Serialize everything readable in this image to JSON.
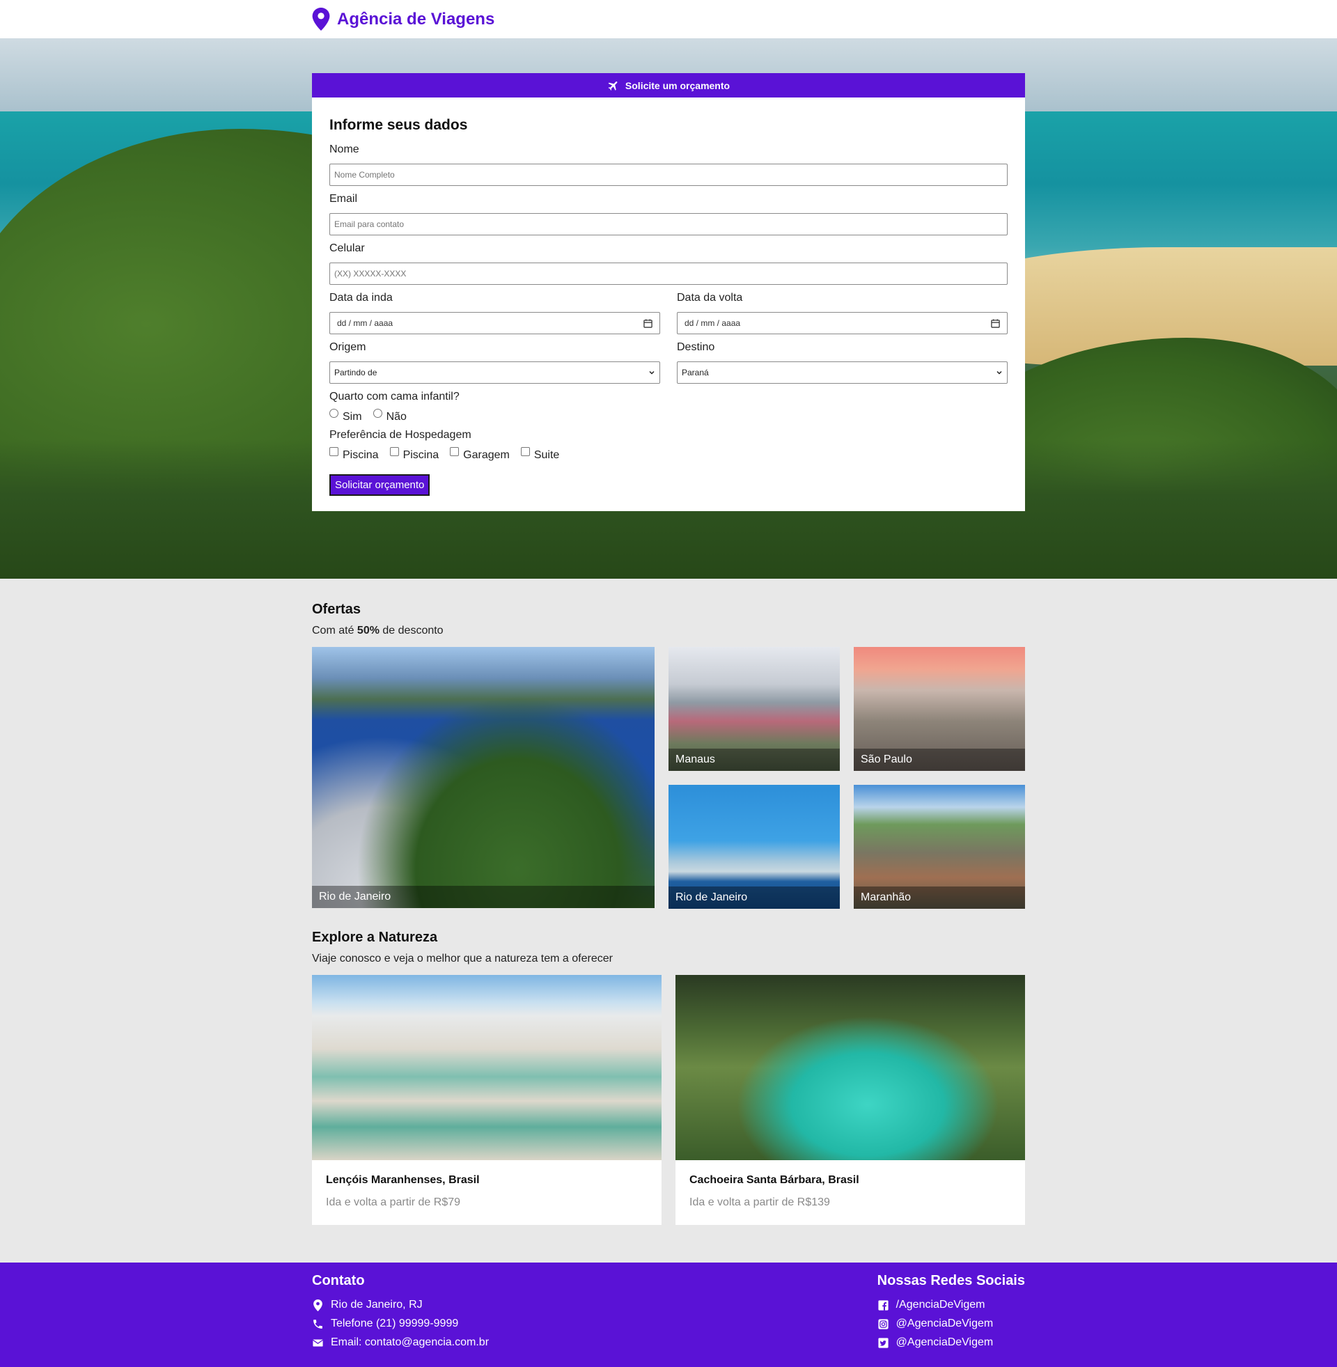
{
  "header": {
    "brand": "Agência de Viagens"
  },
  "form": {
    "banner": "Solicite um orçamento",
    "title": "Informe seus dados",
    "name_label": "Nome",
    "name_placeholder": "Nome Completo",
    "email_label": "Email",
    "email_placeholder": "Email para contato",
    "phone_label": "Celular",
    "phone_placeholder": "(XX) XXXXX-XXXX",
    "depart_label": "Data da inda",
    "depart_value": "dd / mm / aaaa",
    "return_label": "Data da volta",
    "return_value": "dd / mm / aaaa",
    "origin_label": "Origem",
    "origin_value": "Partindo de",
    "dest_label": "Destino",
    "dest_value": "Paraná",
    "child_bed_label": "Quarto com cama infantil?",
    "child_bed_options": [
      "Sim",
      "Não"
    ],
    "pref_label": "Preferência de Hospedagem",
    "pref_options": [
      "Piscina",
      "Piscina",
      "Garagem",
      "Suite"
    ],
    "submit": "Solicitar orçamento"
  },
  "offers": {
    "title": "Ofertas",
    "subtitle_pre": "Com até ",
    "subtitle_bold": "50%",
    "subtitle_post": " de desconto",
    "items": [
      "Rio de Janeiro",
      "Manaus",
      "São Paulo",
      "Rio de Janeiro",
      "Maranhão"
    ]
  },
  "nature": {
    "title": "Explore a Natureza",
    "subtitle": "Viaje conosco e veja o melhor que a natureza tem a oferecer",
    "cards": [
      {
        "title": "Lençóis Maranhenses, Brasil",
        "price": "Ida e volta a partir de R$79"
      },
      {
        "title": "Cachoeira Santa Bárbara, Brasil",
        "price": "Ida e volta a partir de R$139"
      }
    ]
  },
  "footer": {
    "contact_title": "Contato",
    "contact": [
      "Rio de Janeiro, RJ",
      "Telefone (21) 99999-9999",
      "Email: contato@agencia.com.br"
    ],
    "social_title": "Nossas Redes Sociais",
    "social": [
      "/AgenciaDeVigem",
      "@AgenciaDeVigem",
      "@AgenciaDeVigem"
    ]
  },
  "colors": {
    "accent": "#5a12d6",
    "background": "#e8e8e8"
  },
  "icons": [
    "map-pin-icon",
    "airplane-icon",
    "calendar-icon",
    "chevron-down-icon",
    "phone-icon",
    "mail-icon",
    "facebook-icon",
    "instagram-icon",
    "twitter-icon"
  ]
}
